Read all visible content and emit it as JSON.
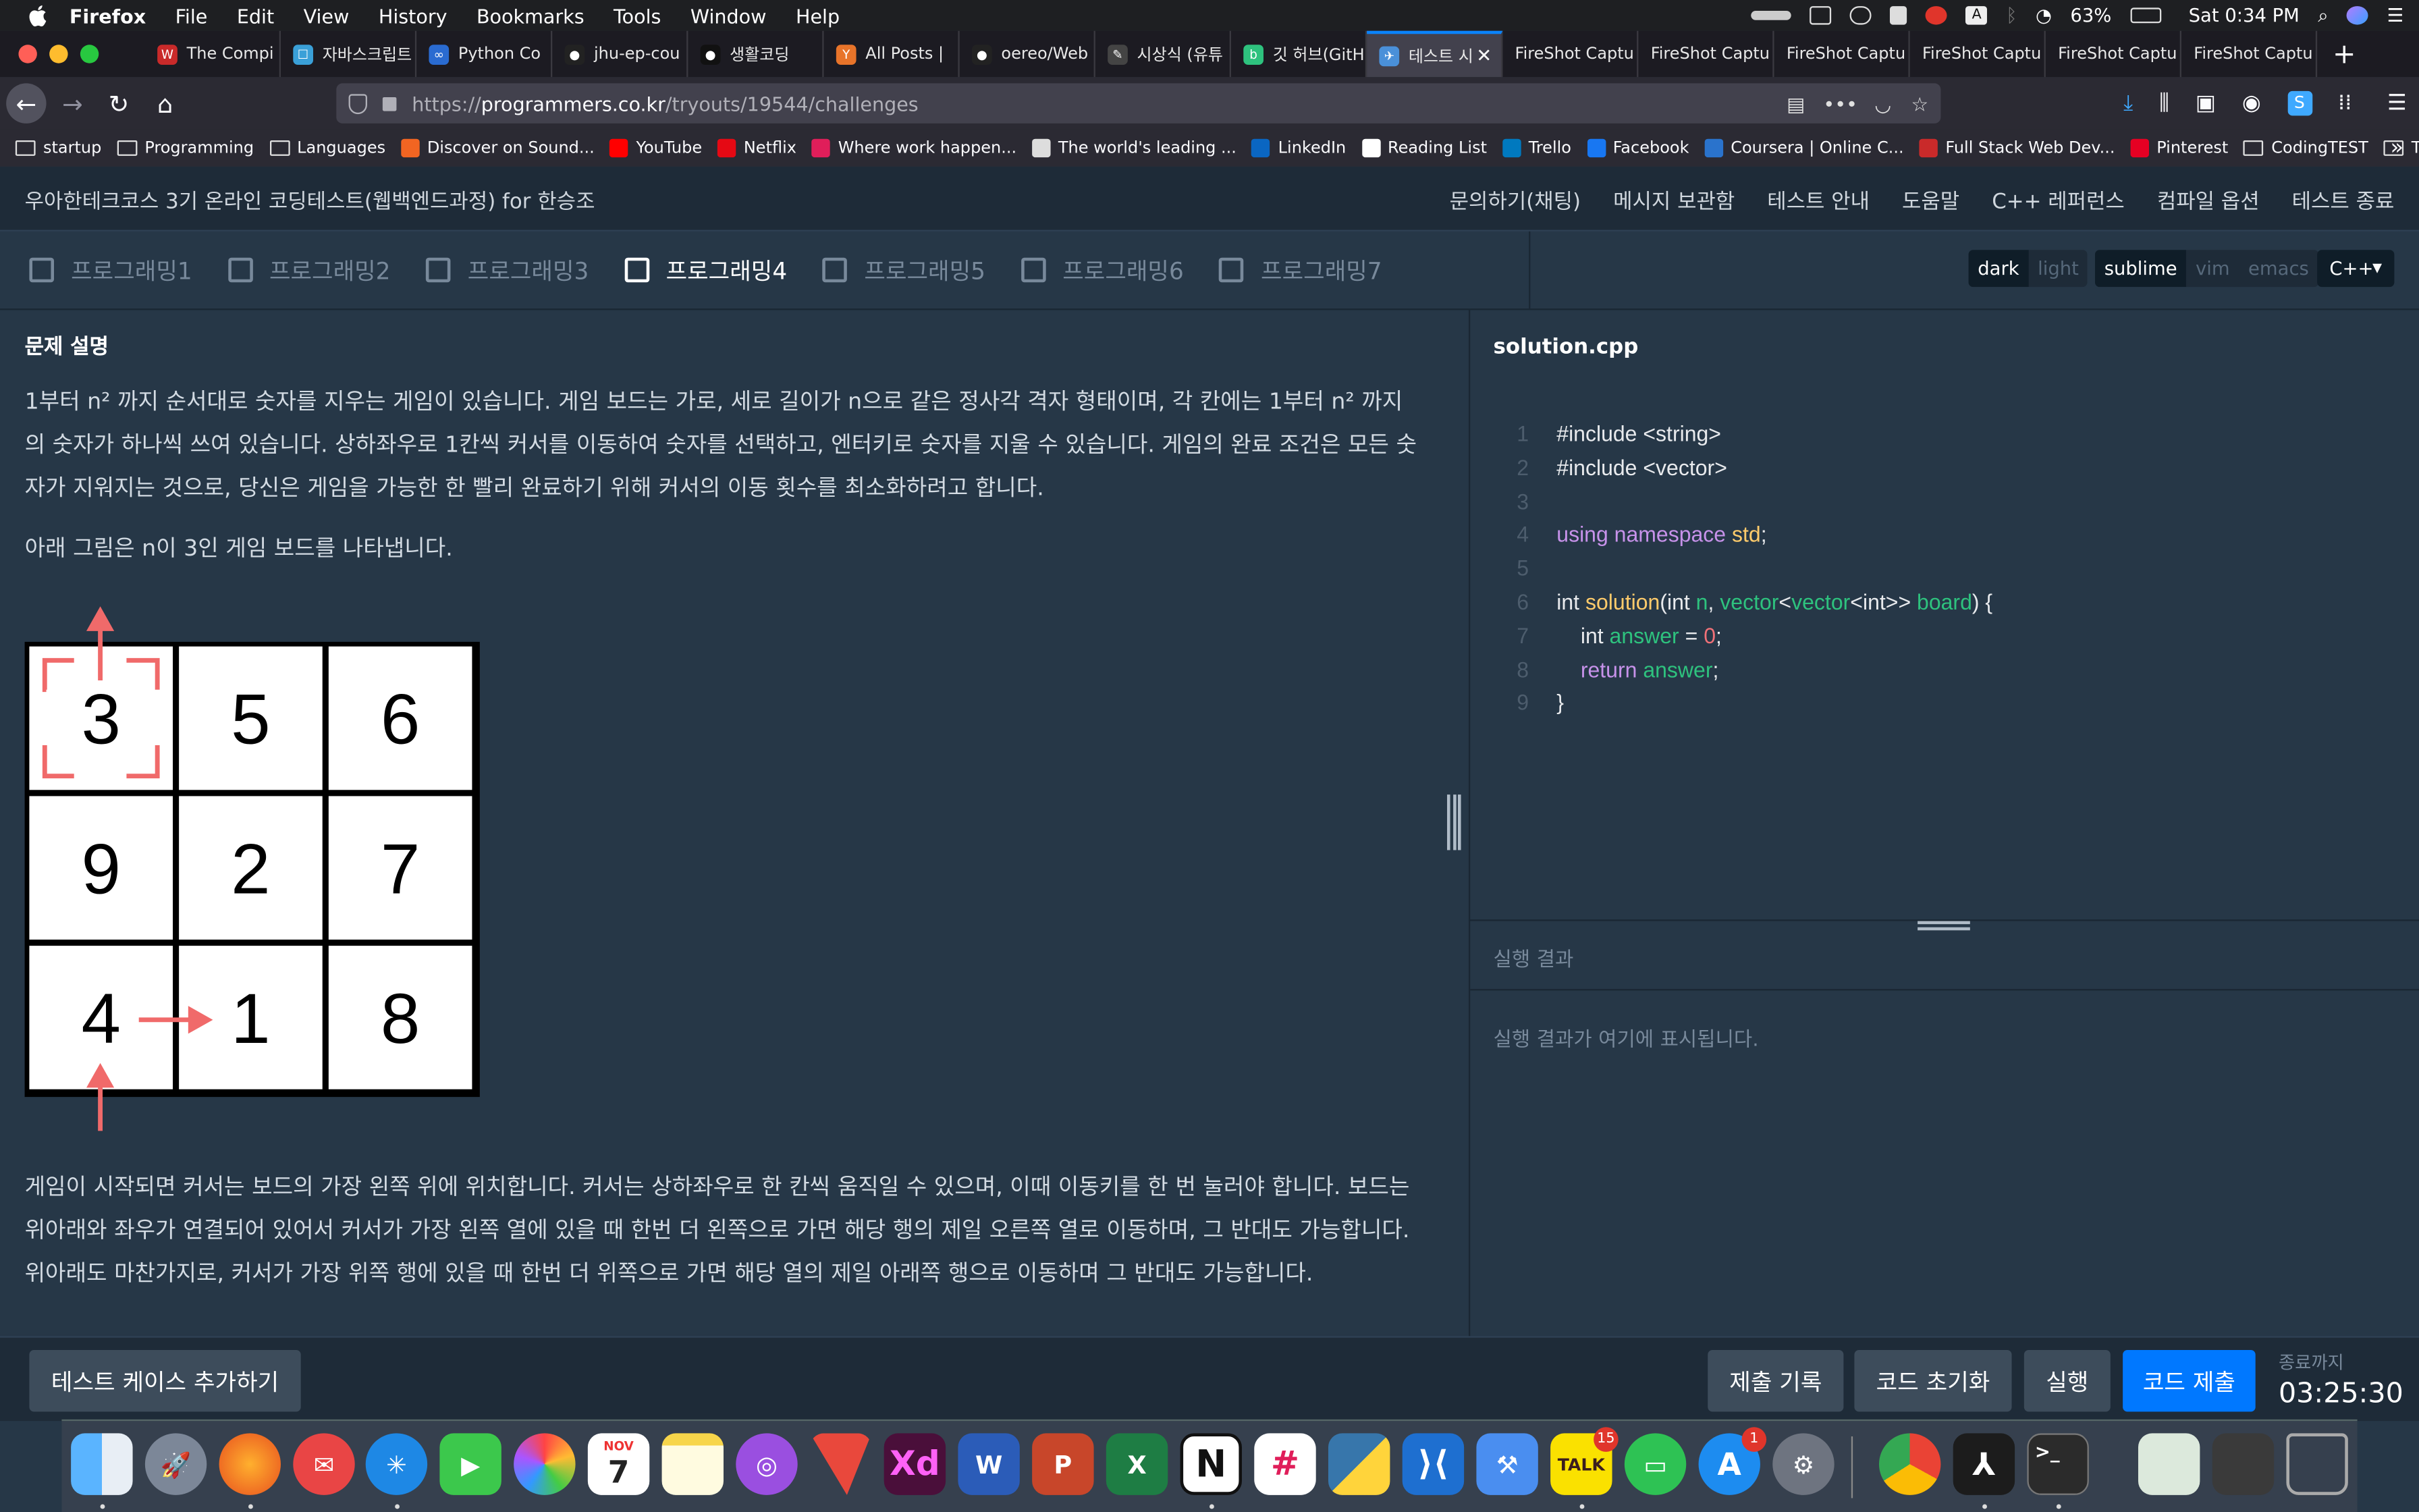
{
  "menubar": {
    "app": "Firefox",
    "items": [
      "File",
      "Edit",
      "View",
      "History",
      "Bookmarks",
      "Tools",
      "Window",
      "Help"
    ],
    "battery": "63%",
    "clock": "Sat 0:34 PM"
  },
  "browser": {
    "tabs": [
      {
        "title": "The Compi",
        "color": "#c92a2a",
        "glyph": "W"
      },
      {
        "title": "자바스크립트",
        "color": "#3aa0d8",
        "glyph": "☐"
      },
      {
        "title": "Python Co",
        "color": "#2a6bd1",
        "glyph": "∞"
      },
      {
        "title": "jhu-ep-cou",
        "color": "#222222",
        "glyph": "●"
      },
      {
        "title": "생활코딩",
        "color": "#111111",
        "glyph": "●"
      },
      {
        "title": "All Posts |",
        "color": "#e8742a",
        "glyph": "Y"
      },
      {
        "title": "oereo/Web",
        "color": "#222222",
        "glyph": "●"
      },
      {
        "title": "시상식 (유튜",
        "color": "#444444",
        "glyph": "✎"
      },
      {
        "title": "깃 허브(GitH",
        "color": "#2ec27e",
        "glyph": "b"
      },
      {
        "title": "테스트 시",
        "color": "#4a90d9",
        "glyph": "✈",
        "active": true
      },
      {
        "title": "FireShot Captu",
        "color": "",
        "glyph": ""
      },
      {
        "title": "FireShot Captu",
        "color": "",
        "glyph": ""
      },
      {
        "title": "FireShot Captu",
        "color": "",
        "glyph": ""
      },
      {
        "title": "FireShot Captu",
        "color": "",
        "glyph": ""
      },
      {
        "title": "FireShot Captu",
        "color": "",
        "glyph": ""
      },
      {
        "title": "FireShot Captu",
        "color": "",
        "glyph": ""
      }
    ],
    "url_prefix": "https://",
    "url_host": "programmers.co.kr",
    "url_path": "/tryouts/19544/challenges",
    "bookmarks": [
      {
        "label": "startup",
        "type": "folder"
      },
      {
        "label": "Programming",
        "type": "folder"
      },
      {
        "label": "Languages",
        "type": "folder"
      },
      {
        "label": "Discover on Sound...",
        "type": "site",
        "color": "#f26522"
      },
      {
        "label": "YouTube",
        "type": "site",
        "color": "#ff0000"
      },
      {
        "label": "Netflix",
        "type": "site",
        "color": "#e50914"
      },
      {
        "label": "Where work happen...",
        "type": "site",
        "color": "#e01e5a"
      },
      {
        "label": "The world's leading ...",
        "type": "site",
        "color": "#dddddd"
      },
      {
        "label": "LinkedIn",
        "type": "site",
        "color": "#0a66c2"
      },
      {
        "label": "Reading List",
        "type": "site",
        "color": "#ffffff"
      },
      {
        "label": "Trello",
        "type": "site",
        "color": "#0079bf"
      },
      {
        "label": "Facebook",
        "type": "site",
        "color": "#1877f2"
      },
      {
        "label": "Coursera | Online C...",
        "type": "site",
        "color": "#2a73cc"
      },
      {
        "label": "Full Stack Web Dev...",
        "type": "site",
        "color": "#c92a2a"
      },
      {
        "label": "Pinterest",
        "type": "site",
        "color": "#e60023"
      },
      {
        "label": "CodingTEST",
        "type": "folder"
      },
      {
        "label": "Travel",
        "type": "folder"
      }
    ]
  },
  "page": {
    "title": "우아한테크코스 3기 온라인 코딩테스트(웹백엔드과정) for 한승조",
    "nav": [
      "문의하기(채팅)",
      "메시지 보관함",
      "테스트 안내",
      "도움말",
      "C++ 레퍼런스",
      "컴파일 옵션",
      "테스트 종료"
    ],
    "problem_tabs": [
      {
        "label": "프로그래밍1",
        "active": false
      },
      {
        "label": "프로그래밍2",
        "active": false
      },
      {
        "label": "프로그래밍3",
        "active": false
      },
      {
        "label": "프로그래밍4",
        "active": true
      },
      {
        "label": "프로그래밍5",
        "active": false
      },
      {
        "label": "프로그래밍6",
        "active": false
      },
      {
        "label": "프로그래밍7",
        "active": false
      }
    ],
    "theme": {
      "dark": "dark",
      "light": "light"
    },
    "keymap": {
      "sublime": "sublime",
      "vim": "vim",
      "emacs": "emacs"
    },
    "language": "C++"
  },
  "problem": {
    "heading": "문제 설명",
    "p1": "1부터 n² 까지 순서대로 숫자를 지우는 게임이 있습니다. 게임 보드는 가로, 세로 길이가 n으로 같은 정사각 격자 형태이며, 각 칸에는 1부터 n² 까지의 숫자가 하나씩 쓰여 있습니다. 상하좌우로 1칸씩 커서를 이동하여 숫자를 선택하고, 엔터키로 숫자를 지울 수 있습니다. 게임의 완료 조건은 모든 숫자가 지워지는 것으로, 당신은 게임을 가능한 한 빨리 완료하기 위해 커서의 이동 횟수를 최소화하려고 합니다.",
    "p2": "아래 그림은 n이 3인 게임 보드를 나타냅니다.",
    "board": [
      [
        "3",
        "5",
        "6"
      ],
      [
        "9",
        "2",
        "7"
      ],
      [
        "4",
        "1",
        "8"
      ]
    ],
    "p3": "게임이 시작되면 커서는 보드의 가장 왼쪽 위에 위치합니다. 커서는 상하좌우로 한 칸씩 움직일 수 있으며, 이때 이동키를 한 번 눌러야 합니다. 보드는 위아래와 좌우가 연결되어 있어서 커서가 가장 왼쪽 열에 있을 때 한번 더 왼쪽으로 가면 해당 행의 제일 오른쪽 열로 이동하며, 그 반대도 가능합니다. 위아래도 마찬가지로, 커서가 가장 위쪽 행에 있을 때 한번 더 위쪽으로 가면 해당 열의 제일 아래쪽 행으로 이동하며 그 반대도 가능합니다."
  },
  "editor": {
    "filename": "solution.cpp",
    "lines": [
      "1",
      "2",
      "3",
      "4",
      "5",
      "6",
      "7",
      "8",
      "9"
    ]
  },
  "result": {
    "heading": "실행 결과",
    "placeholder": "실행 결과가 여기에 표시됩니다."
  },
  "footer": {
    "add_testcase": "테스트 케이스 추가하기",
    "history": "제출 기록",
    "reset": "코드 초기화",
    "run": "실행",
    "submit": "코드 제출",
    "timer_label": "종료까지",
    "timer_value": "03:25:30"
  },
  "dock": {
    "calendar_month": "NOV",
    "calendar_day": "7",
    "talk_badge": "15",
    "appstore_badge": "1"
  }
}
